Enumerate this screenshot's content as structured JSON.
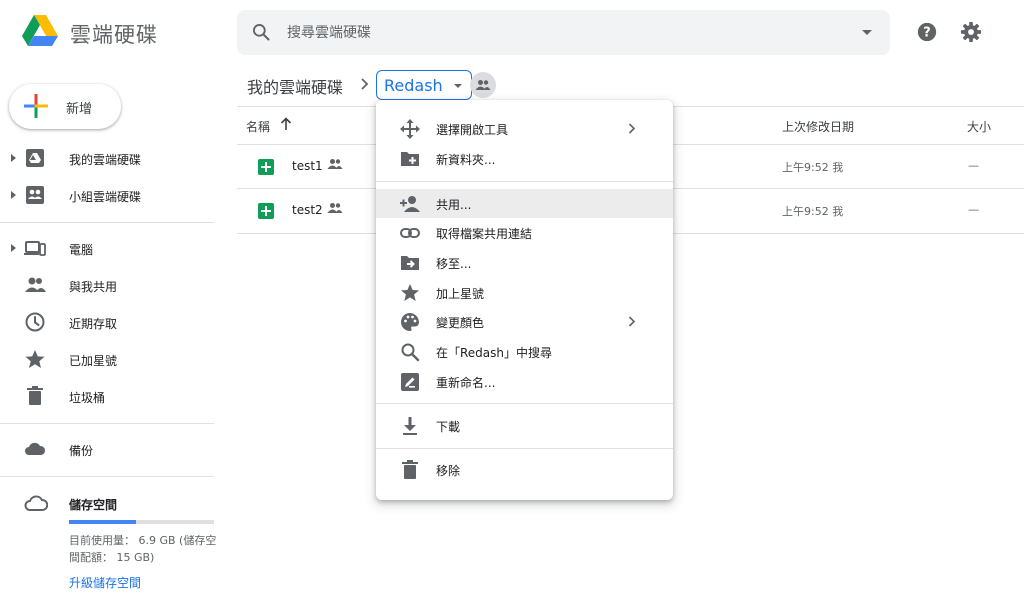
{
  "app": {
    "title": "雲端硬碟",
    "search_placeholder": "搜尋雲端硬碟"
  },
  "new_button": {
    "label": "新增"
  },
  "sidebar": {
    "items": [
      {
        "label": "我的雲端硬碟",
        "icon": "my-drive-icon",
        "expandable": true
      },
      {
        "label": "小組雲端硬碟",
        "icon": "shared-drives-icon",
        "expandable": true
      },
      {
        "label": "電腦",
        "icon": "computers-icon",
        "expandable": true
      },
      {
        "label": "與我共用",
        "icon": "shared-with-me-icon",
        "expandable": false
      },
      {
        "label": "近期存取",
        "icon": "recent-icon",
        "expandable": false
      },
      {
        "label": "已加星號",
        "icon": "starred-icon",
        "expandable": false
      },
      {
        "label": "垃圾桶",
        "icon": "trash-icon",
        "expandable": false
      },
      {
        "label": "備份",
        "icon": "backups-icon",
        "expandable": false
      }
    ],
    "storage": {
      "title": "儲存空間",
      "usage_text": "目前使用量： 6.9 GB (儲存空間配額： 15 GB)",
      "used_fraction": 0.46,
      "upgrade_label": "升級儲存空間"
    }
  },
  "breadcrumb": {
    "root": "我的雲端硬碟",
    "current": "Redash"
  },
  "table": {
    "columns": {
      "name": "名稱",
      "modified": "上次修改日期",
      "size": "大小"
    },
    "rows": [
      {
        "name": "test1",
        "modified": "上午9:52 我",
        "size": "—"
      },
      {
        "name": "test2",
        "modified": "上午9:52 我",
        "size": "—"
      }
    ]
  },
  "context_menu": {
    "items": [
      {
        "label": "選擇開啟工具",
        "icon": "open-with-icon",
        "submenu": true
      },
      {
        "label": "新資料夾...",
        "icon": "new-folder-icon"
      },
      {
        "label": "共用...",
        "icon": "add-person-icon",
        "hovered": true
      },
      {
        "label": "取得檔案共用連結",
        "icon": "link-icon"
      },
      {
        "label": "移至...",
        "icon": "move-to-icon"
      },
      {
        "label": "加上星號",
        "icon": "star-icon"
      },
      {
        "label": "變更顏色",
        "icon": "palette-icon",
        "submenu": true
      },
      {
        "label": "在「Redash」中搜尋",
        "icon": "search-icon"
      },
      {
        "label": "重新命名...",
        "icon": "rename-icon"
      },
      {
        "label": "下載",
        "icon": "download-icon"
      },
      {
        "label": "移除",
        "icon": "trash-icon"
      }
    ]
  },
  "colors": {
    "accent": "#1a73e8",
    "icon_gray": "#5f6368",
    "sheets_green": "#0f9d58",
    "menu_hover": "#ececec"
  }
}
